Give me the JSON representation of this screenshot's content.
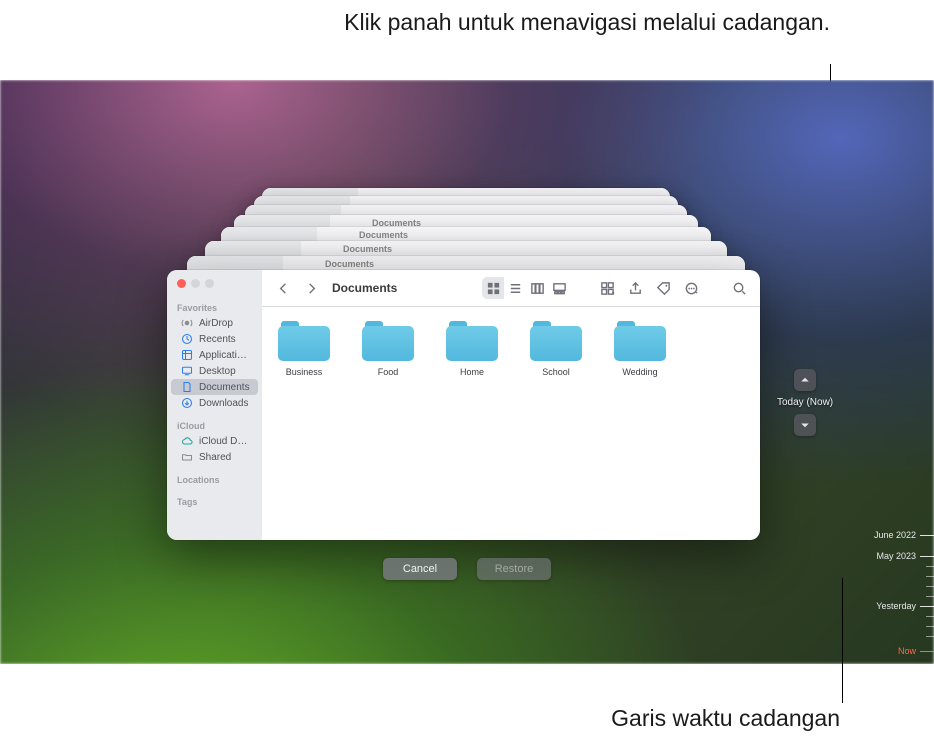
{
  "annotations": {
    "arrows": "Klik panah untuk menavigasi melalui cadangan.",
    "timeline": "Garis waktu cadangan"
  },
  "nav": {
    "status": "Today (Now)"
  },
  "timeline_labels": {
    "l0": "June 2022",
    "l1": "May 2023",
    "l2": "Yesterday",
    "l3": "Now"
  },
  "window": {
    "title": "Documents"
  },
  "sidebar": {
    "groups": {
      "favorites": "Favorites",
      "icloud": "iCloud",
      "locations": "Locations",
      "tags": "Tags"
    },
    "items": {
      "airdrop": "AirDrop",
      "recents": "Recents",
      "applications": "Applications",
      "desktop": "Desktop",
      "documents": "Documents",
      "downloads": "Downloads",
      "iclouddrive": "iCloud Drive",
      "shared": "Shared"
    }
  },
  "folders": {
    "f0": "Business",
    "f1": "Food",
    "f2": "Home",
    "f3": "School",
    "f4": "Wedding"
  },
  "actions": {
    "cancel": "Cancel",
    "restore": "Restore"
  }
}
